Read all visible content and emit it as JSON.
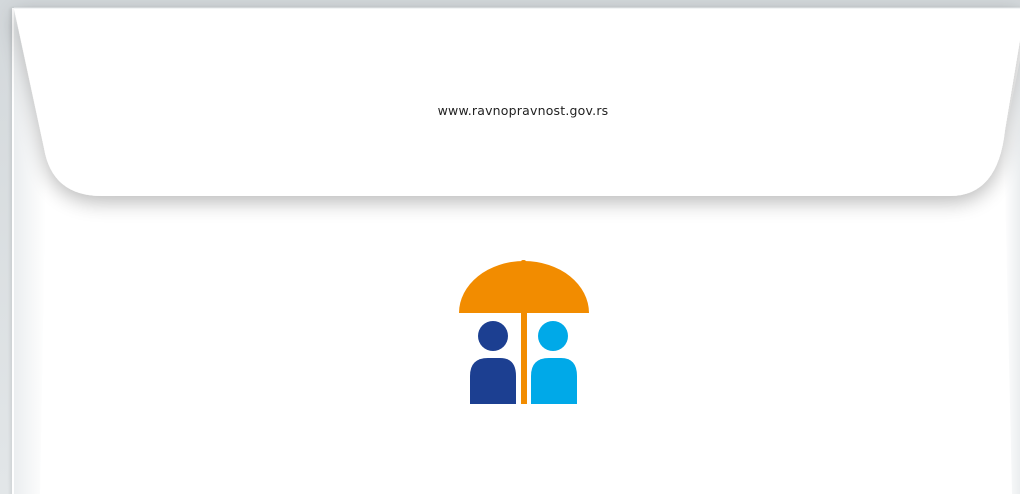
{
  "envelope": {
    "website": "www.ravnopravnost.gov.rs",
    "logo_icon": "umbrella-two-people-icon",
    "colors": {
      "umbrella": "#f28c00",
      "person_left": "#1c3f91",
      "person_right": "#00a9e8",
      "paper": "#ffffff"
    }
  }
}
